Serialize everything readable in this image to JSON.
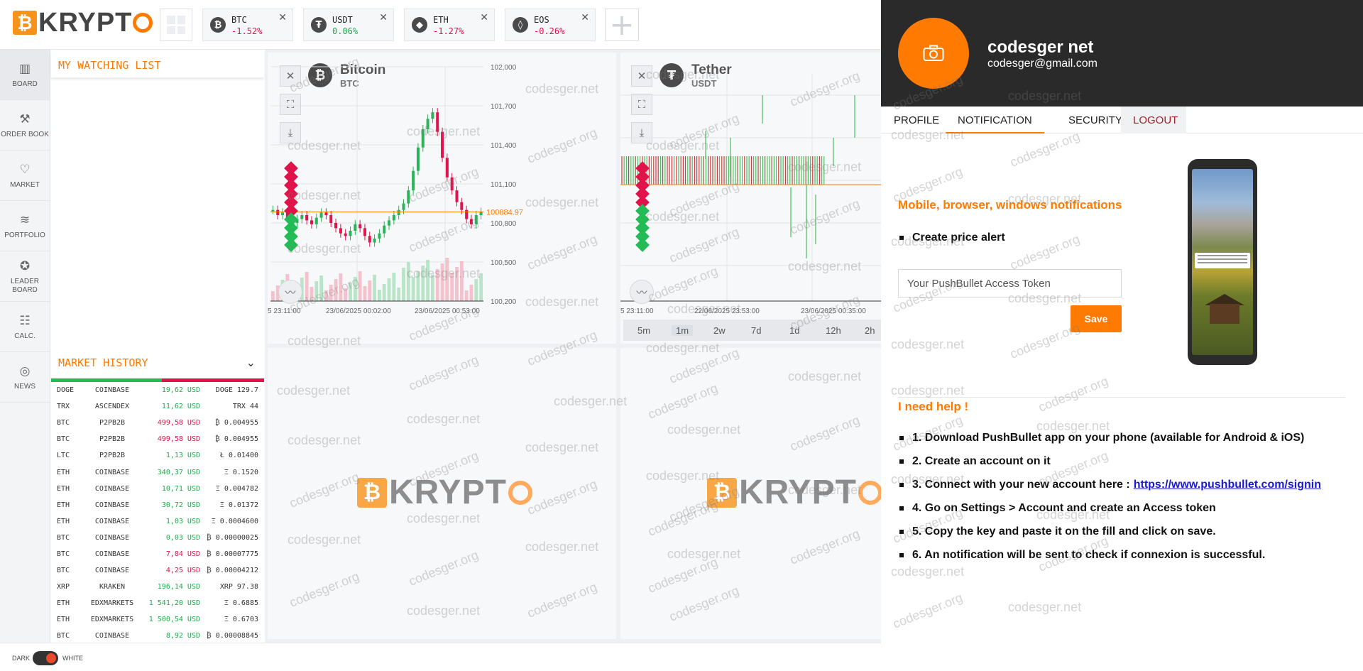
{
  "header": {
    "logo_b": "₿",
    "logo_text": "KRYPT",
    "tickers": [
      {
        "symbol": "BTC",
        "change": "-1.52%",
        "icon": "₿",
        "dir": "neg"
      },
      {
        "symbol": "USDT",
        "change": "0.06%",
        "icon": "₮",
        "dir": "pos"
      },
      {
        "symbol": "ETH",
        "change": "-1.27%",
        "icon": "◆",
        "dir": "neg"
      },
      {
        "symbol": "EOS",
        "change": "-0.26%",
        "icon": "◊",
        "dir": "neg"
      }
    ],
    "add_label": "+"
  },
  "sidebar": {
    "items": [
      {
        "label": "BOARD",
        "icon": "▥"
      },
      {
        "label": "ORDER BOOK",
        "icon": "⚒"
      },
      {
        "label": "MARKET",
        "icon": "♡"
      },
      {
        "label": "PORTFOLIO",
        "icon": "≋"
      },
      {
        "label": "LEADER\nBOARD",
        "icon": "✪"
      },
      {
        "label": "CALC.",
        "icon": "☷"
      },
      {
        "label": "NEWS",
        "icon": "◎"
      }
    ]
  },
  "watchlist": {
    "title": "MY WATCHING LIST"
  },
  "history": {
    "title": "MARKET HISTORY",
    "rows": [
      [
        "DOGE",
        "COINBASE",
        "19,62 USD",
        "DOGE 129.7",
        "pos"
      ],
      [
        "TRX",
        "ASCENDEX",
        "11,62 USD",
        "TRX 44",
        "pos"
      ],
      [
        "BTC",
        "P2PB2B",
        "499,58 USD",
        "₿ 0.004955",
        "neg"
      ],
      [
        "BTC",
        "P2PB2B",
        "499,58 USD",
        "₿ 0.004955",
        "neg"
      ],
      [
        "LTC",
        "P2PB2B",
        "1,13 USD",
        "Ł 0.01400",
        "pos"
      ],
      [
        "ETH",
        "COINBASE",
        "340,37 USD",
        "Ξ 0.1520",
        "pos"
      ],
      [
        "ETH",
        "COINBASE",
        "10,71 USD",
        "Ξ 0.004782",
        "pos"
      ],
      [
        "ETH",
        "COINBASE",
        "30,72 USD",
        "Ξ 0.01372",
        "pos"
      ],
      [
        "ETH",
        "COINBASE",
        "1,03 USD",
        "Ξ 0.0004600",
        "pos"
      ],
      [
        "BTC",
        "COINBASE",
        "0,03 USD",
        "₿ 0.00000025",
        "pos"
      ],
      [
        "BTC",
        "COINBASE",
        "7,84 USD",
        "₿ 0.00007775",
        "neg"
      ],
      [
        "BTC",
        "COINBASE",
        "4,25 USD",
        "₿ 0.00004212",
        "neg"
      ],
      [
        "XRP",
        "KRAKEN",
        "196,14 USD",
        "XRP 97.38",
        "pos"
      ],
      [
        "ETH",
        "EDXMARKETS",
        "1 541,20 USD",
        "Ξ 0.6885",
        "pos"
      ],
      [
        "ETH",
        "EDXMARKETS",
        "1 500,54 USD",
        "Ξ 0.6703",
        "pos"
      ],
      [
        "BTC",
        "COINBASE",
        "8,92 USD",
        "₿ 0.00008845",
        "pos"
      ]
    ]
  },
  "chart_data": [
    {
      "type": "line",
      "title": "Bitcoin",
      "subtitle": "BTC",
      "ylim": [
        100200,
        102000
      ],
      "y_ticks": [
        "102,000",
        "101,700",
        "101,400",
        "101,100",
        "100,800",
        "100,500",
        "100,200"
      ],
      "x_ticks": [
        "5 23:11:00",
        "23/06/2025 00:02:00",
        "23/06/2025 00:53:00"
      ],
      "last_price": "100884.97",
      "y": [
        100900,
        100860,
        100880,
        100840,
        100800,
        100830,
        100860,
        100820,
        100790,
        100840,
        100880,
        100860,
        100800,
        100760,
        100720,
        100700,
        100740,
        100790,
        100760,
        100700,
        100650,
        100680,
        100720,
        100780,
        100820,
        100860,
        100900,
        100950,
        101050,
        101200,
        101380,
        101520,
        101600,
        101650,
        101500,
        101300,
        101150,
        101050,
        100960,
        100900,
        100830,
        100790,
        100860,
        100885
      ]
    },
    {
      "type": "bar",
      "title": "Tether",
      "subtitle": "USDT",
      "x_ticks": [
        "5 23:11:00",
        "22/06/2025 23:53:00",
        "23/06/2025 00:35:00"
      ],
      "timeframes": [
        "5m",
        "1m",
        "2w",
        "7d",
        "1d",
        "12h",
        "2h"
      ]
    }
  ],
  "panels": {
    "logo_text": "KRYPT",
    "watermark_org": "codesger.org",
    "watermark_net": "codesger.net"
  },
  "footer": {
    "dark": "DARK",
    "white": "WHITE"
  },
  "profile": {
    "name": "codesger net",
    "email": "codesger@gmail.com",
    "tabs": [
      "PROFILE",
      "NOTIFICATION",
      "SECURITY",
      "LOGOUT"
    ],
    "notif_title": "Mobile, browser, windows notifications",
    "price_alert": "Create price alert",
    "token_placeholder": "Your PushBullet Access Token",
    "save": "Save",
    "help_title": "I need help !",
    "steps": [
      "1. Download PushBullet app on your phone (available for Android & iOS)",
      "2. Create an account on it",
      "3. Connect with your new account here :",
      "4. Go on Settings > Account and create an Access token",
      "5. Copy the key and paste it on the fill and click on save.",
      "6. An notification will be sent to check if connexion is successful."
    ],
    "signin_link": "https://www.pushbullet.com/signin"
  },
  "colors": {
    "accent": "#ff7a00",
    "up": "#1aae4b",
    "down": "#e0134a",
    "dark": "#2a2a2a"
  }
}
